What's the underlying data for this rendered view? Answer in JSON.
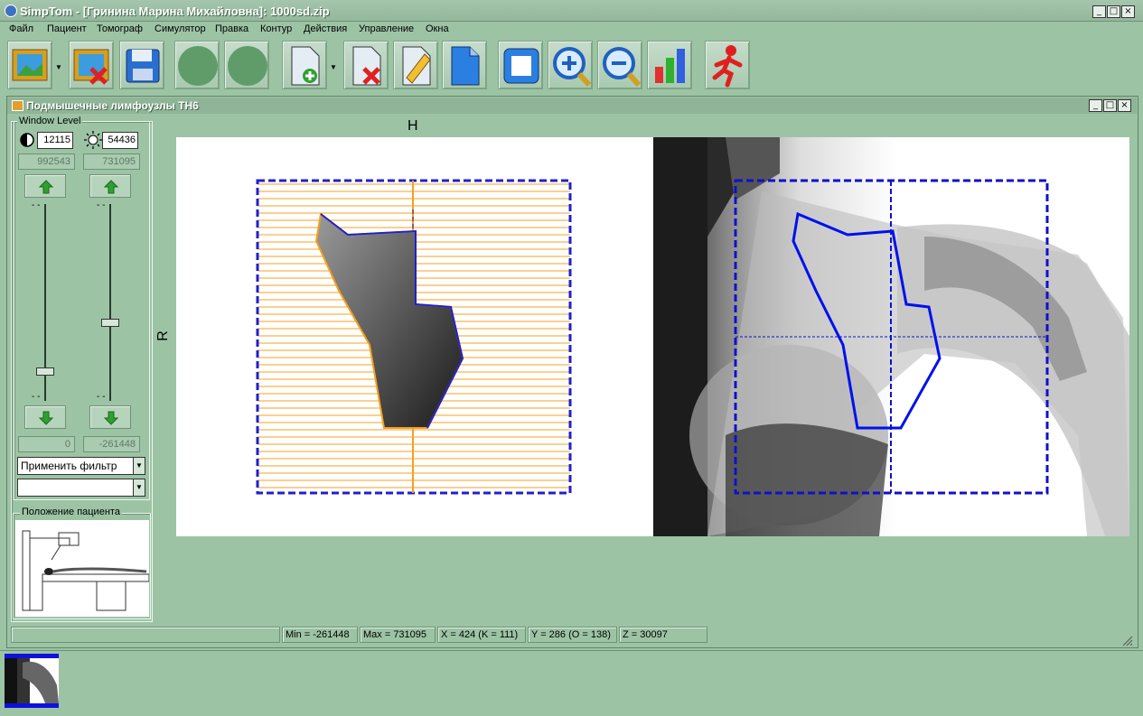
{
  "app": {
    "title": "SimpTom - [Гринина Марина Михайловна]: 1000sd.zip",
    "window_buttons": [
      "_",
      "□",
      "×"
    ]
  },
  "menu": [
    "Файл",
    "Пациент",
    "Томограф",
    "Симулятор",
    "Правка",
    "Контур",
    "Действия",
    "Управление",
    "Окна"
  ],
  "toolbar": [
    {
      "name": "open-image",
      "icon": "picture-frame-icon"
    },
    {
      "name": "close-image",
      "icon": "picture-delete-icon"
    },
    {
      "name": "save",
      "icon": "floppy-icon"
    },
    {
      "name": "circle-1",
      "icon": "green-circle-icon"
    },
    {
      "name": "circle-2",
      "icon": "green-circle-icon"
    },
    {
      "name": "new-document",
      "icon": "page-add-icon"
    },
    {
      "name": "delete-document",
      "icon": "page-delete-icon"
    },
    {
      "name": "edit-document",
      "icon": "page-edit-icon"
    },
    {
      "name": "blank-document",
      "icon": "page-icon"
    },
    {
      "name": "fit",
      "icon": "frame-icon"
    },
    {
      "name": "zoom-in",
      "icon": "zoom-in-icon"
    },
    {
      "name": "zoom-out",
      "icon": "zoom-out-icon"
    },
    {
      "name": "chart",
      "icon": "bar-chart-icon"
    },
    {
      "name": "exit",
      "icon": "running-man-icon"
    }
  ],
  "child": {
    "title": "Подмышечные лимфоузлы ТН6",
    "window_buttons": [
      "_",
      "□",
      "×"
    ]
  },
  "window_level": {
    "legend": "Window Level",
    "contrast_value": "12115",
    "brightness_value": "54436",
    "max_left": "992543",
    "max_right": "731095",
    "min_left": "0",
    "min_right": "-261448",
    "tick_left_top": "-   -",
    "tick_right_top": "-   -",
    "tick_left_bottom": "-   -",
    "tick_right_bottom": "-   -",
    "slider_left_level": 0.85,
    "slider_right_level": 0.6
  },
  "filter_combo": "Применить фильтр",
  "second_combo": "",
  "patient_position": {
    "legend": "Положение пациента"
  },
  "view": {
    "label_top": "H",
    "label_left": "R"
  },
  "status": {
    "min": "Min = -261448",
    "max": "Max = 731095",
    "x": "X = 424 (K = 111)",
    "y": "Y = 286 (O = 138)",
    "z": "Z = 30097"
  },
  "colors": {
    "background": "#9cc4a4",
    "contour": "#0000dd",
    "grid": "#f5a020"
  }
}
